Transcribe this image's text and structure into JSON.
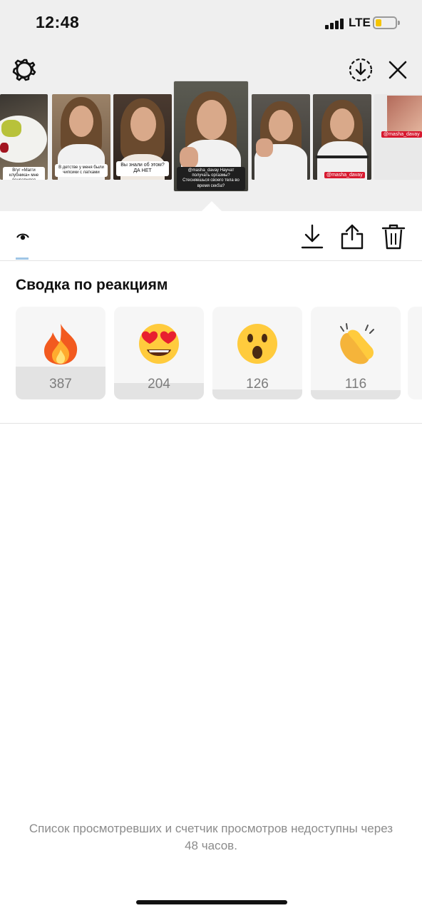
{
  "status_bar": {
    "time": "12:48",
    "network": "LTE",
    "battery_level": 0.3
  },
  "header": {
    "icons": [
      "gear-icon",
      "download-circle-icon",
      "close-icon"
    ]
  },
  "thumbnails": [
    {
      "caption": "Вгуг «Магги клубника» мне понравился больше!",
      "tag": ""
    },
    {
      "caption": "В детстве у меня были чипсики с латками",
      "tag": ""
    },
    {
      "caption": "Вы знали об этом? ДА НЕТ",
      "tag": ""
    },
    {
      "caption": "@masha_davay Научат получать оргазмы? Стесняешься своего тела во время секSa?",
      "tag": ""
    },
    {
      "caption": "",
      "tag": ""
    },
    {
      "caption": "",
      "tag": "@masha_davay"
    },
    {
      "caption": "",
      "tag": "@masha_davay"
    }
  ],
  "toolbar": {
    "icons": [
      "eye-icon",
      "download-icon",
      "share-icon",
      "trash-icon"
    ]
  },
  "reactions_summary": {
    "title": "Сводка по реакциям",
    "items": [
      {
        "emoji": "fire-emoji",
        "count": "387",
        "bar_fraction": 0.35
      },
      {
        "emoji": "heart-eyes-emoji",
        "count": "204",
        "bar_fraction": 0.18
      },
      {
        "emoji": "surprised-face-emoji",
        "count": "126",
        "bar_fraction": 0.11
      },
      {
        "emoji": "clapping-hands-emoji",
        "count": "116",
        "bar_fraction": 0.1
      }
    ]
  },
  "footer": {
    "note": "Список просмотревших и счетчик просмотров недоступны через 48 часов."
  },
  "colors": {
    "top_background": "#efefef",
    "highlight_red": "#d7192f",
    "battery_yellow": "#f5c400"
  }
}
